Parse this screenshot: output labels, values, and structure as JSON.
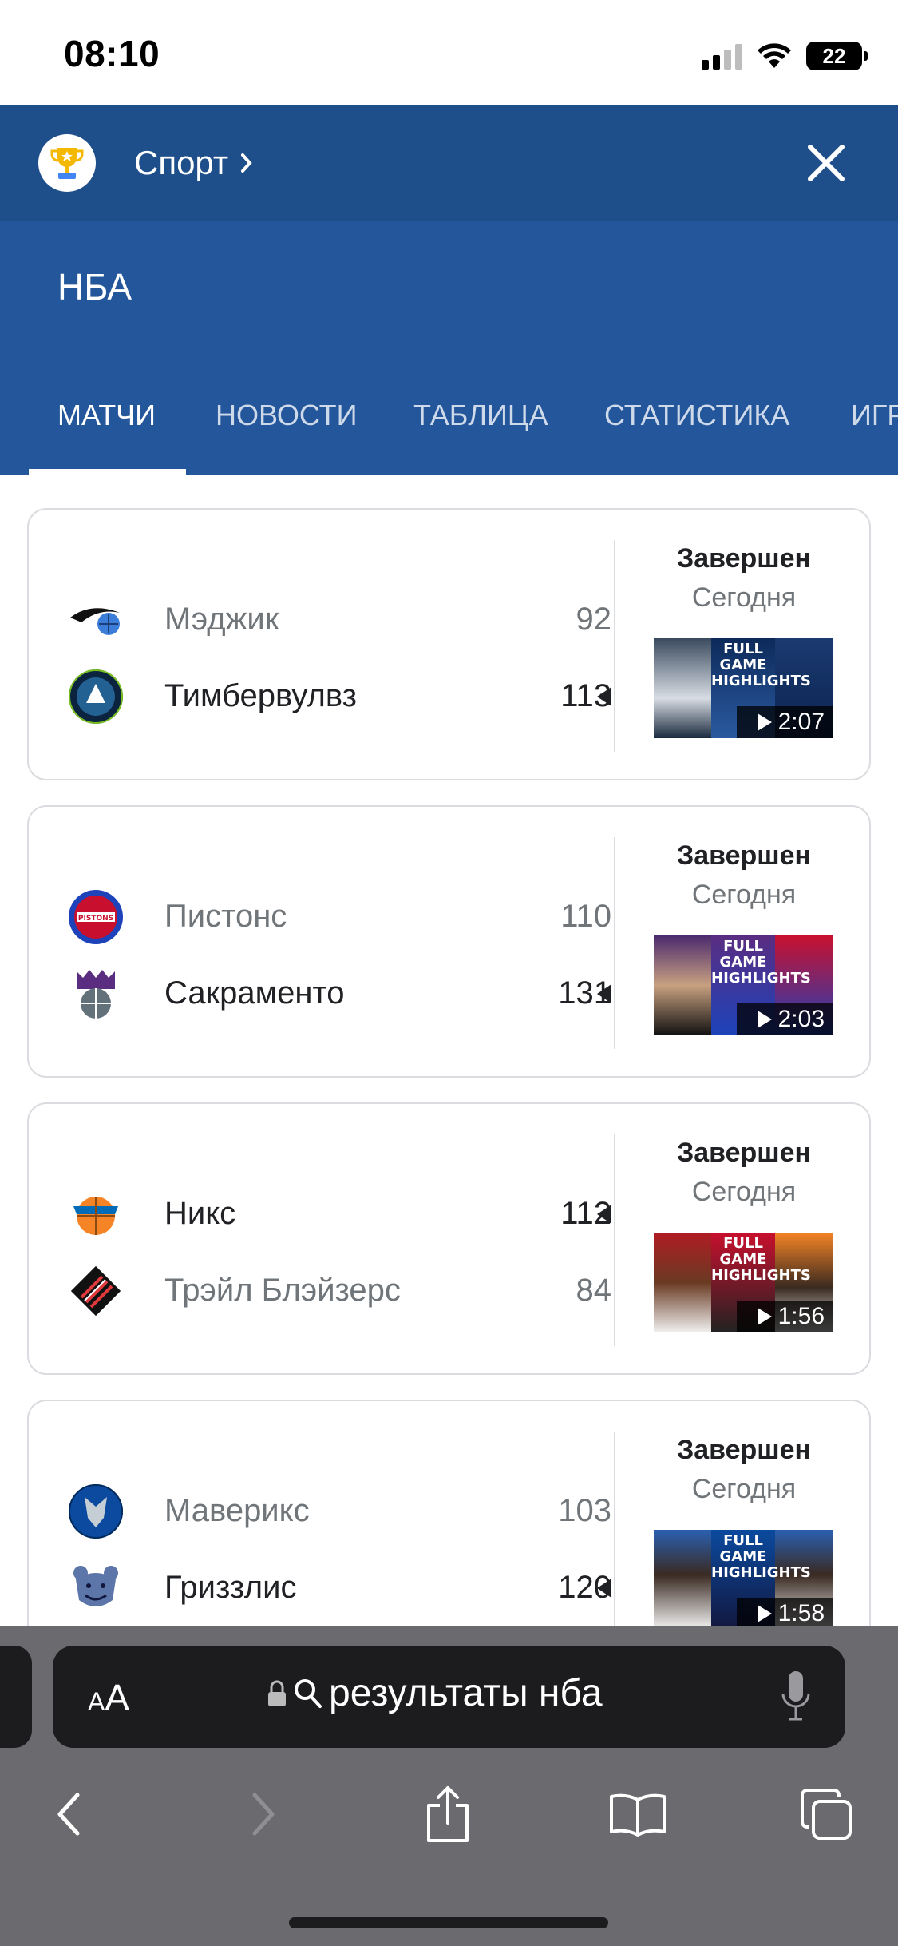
{
  "status_bar": {
    "time": "08:10",
    "battery": "22"
  },
  "header": {
    "section_link": "Спорт",
    "close_icon": "close-icon"
  },
  "league": {
    "title": "НБА",
    "tabs": [
      "МАТЧИ",
      "НОВОСТИ",
      "ТАБЛИЦА",
      "СТАТИСТИКА",
      "ИГРОКИ"
    ]
  },
  "games": [
    {
      "team1": {
        "name": "Мэджик",
        "score": "92",
        "winner": false
      },
      "team2": {
        "name": "Тимбервулвз",
        "score": "113",
        "winner": true
      },
      "status": "Завершен",
      "date": "Сегодня",
      "video": {
        "title": "FULL GAME HIGHLIGHTS",
        "duration": "2:07"
      }
    },
    {
      "team1": {
        "name": "Пистонс",
        "score": "110",
        "winner": false
      },
      "team2": {
        "name": "Сакраменто",
        "score": "131",
        "winner": true
      },
      "status": "Завершен",
      "date": "Сегодня",
      "video": {
        "title": "FULL GAME HIGHLIGHTS",
        "duration": "2:03"
      }
    },
    {
      "team1": {
        "name": "Никс",
        "score": "112",
        "winner": true
      },
      "team2": {
        "name": "Трэйл Блэйзерс",
        "score": "84",
        "winner": false
      },
      "status": "Завершен",
      "date": "Сегодня",
      "video": {
        "title": "FULL GAME HIGHLIGHTS",
        "duration": "1:56"
      }
    },
    {
      "team1": {
        "name": "Маверикс",
        "score": "103",
        "winner": false
      },
      "team2": {
        "name": "Гриззлис",
        "score": "120",
        "winner": true
      },
      "status": "Завершен",
      "date": "Сегодня",
      "video": {
        "title": "FULL GAME HIGHLIGHTS",
        "duration": "1:58"
      }
    }
  ],
  "safari": {
    "aa_label_small": "A",
    "aa_label_big": "A",
    "url_text": "результаты нба"
  },
  "colors": {
    "header_dark": "#1f4f8a",
    "header": "#23569a"
  }
}
